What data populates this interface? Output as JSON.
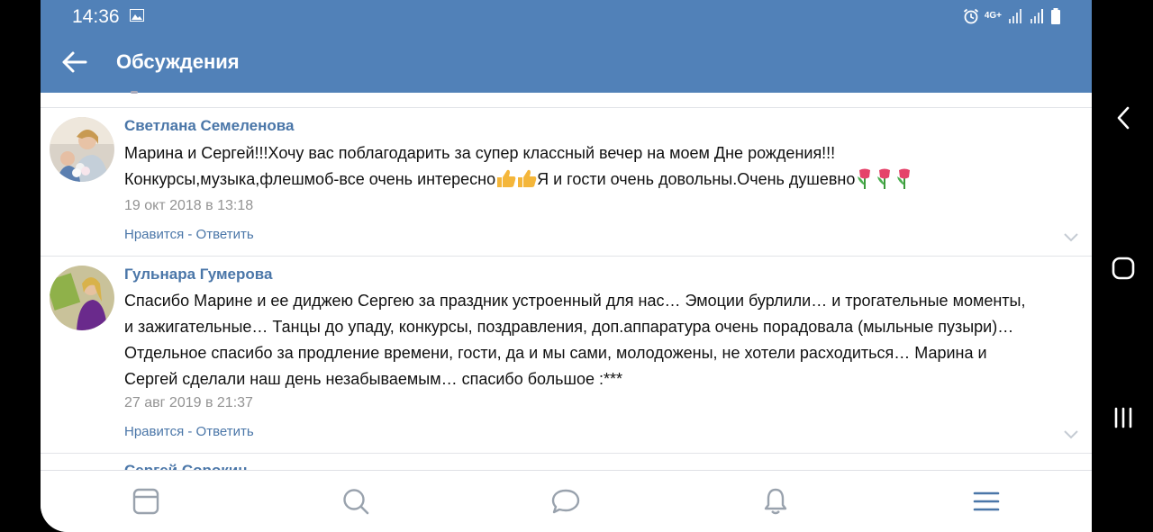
{
  "status_bar": {
    "time": "14:36",
    "network": "4G+"
  },
  "header": {
    "title": "Обсуждения"
  },
  "comments": [
    {
      "author": "Светлана Семеленова",
      "lines": [
        "Марина и Сергей!!!Хочу вас поблагодарить за супер классный вечер на моем Дне рождения!!!",
        "Конкурсы,музыка,флешмоб-все очень интересно",
        "Я и гости очень довольны.Очень душевно"
      ],
      "date": "19 окт 2018 в 13:18",
      "like_label": "Нравится",
      "separator": " - ",
      "reply_label": "Ответить"
    },
    {
      "author": "Гульнара Гумерова",
      "lines": [
        "Спасибо Марине и ее диджею Сергею за праздник устроенный для нас… Эмоции бурлили… и трогательные моменты,",
        "и зажигательные… Танцы до упаду, конкурсы, поздравления, доп.аппаратура очень порадовала (мыльные пузыри)…",
        "Отдельное спасибо за продление времени, гости, да и мы сами, молодожены, не хотели расходиться… Марина и",
        "Сергей сделали наш день незабываемым… спасибо большое :***"
      ],
      "date": "27 авг 2019 в 21:37",
      "like_label": "Нравится",
      "separator": " - ",
      "reply_label": "Ответить"
    },
    {
      "author": "Сергей Сорокин"
    }
  ],
  "icons": {
    "status": [
      "gallery-icon",
      "alarm-icon",
      "signal-icon",
      "battery-icon"
    ],
    "emoji": [
      "thumbs-up-icon",
      "tulip-icon"
    ],
    "nav": [
      "news-icon",
      "search-icon",
      "messages-icon",
      "notifications-icon",
      "menu-icon"
    ],
    "system": [
      "back-chevron-icon",
      "home-icon",
      "recents-icon"
    ]
  },
  "colors": {
    "header": "#5181b8",
    "link": "#4a76a8",
    "muted": "#939393",
    "active_nav": "#4a76a8"
  }
}
